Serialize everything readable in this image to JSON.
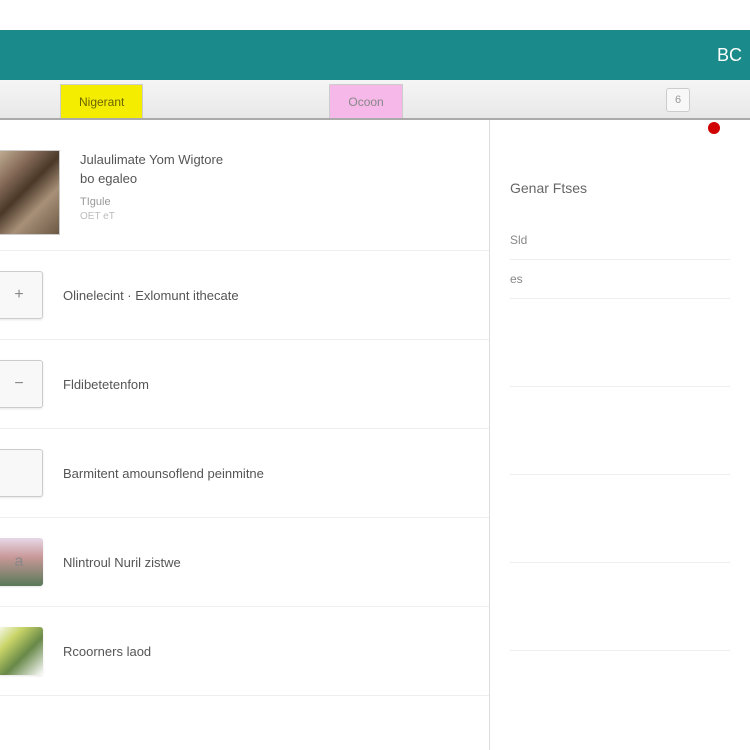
{
  "header": {
    "right_label": "BC"
  },
  "tabs": {
    "active": "Nigerant",
    "secondary": "Ocoon",
    "right_badge": "6"
  },
  "hero": {
    "title": "Julaulimate Yom Wigtore",
    "subtitle": "bo egaleo",
    "meta1": "TIgule",
    "meta2": "OET eT"
  },
  "list": [
    {
      "icon": "+",
      "text": "Olinelecint · Exlomunt ithecate"
    },
    {
      "icon": "−",
      "text": "Fldibetetenfom"
    },
    {
      "icon": "",
      "text": "Barmitent amounsoflend peinmitne"
    },
    {
      "icon": "a",
      "text": "Nlintroul Nuril zistwe"
    },
    {
      "icon": "",
      "text": "Rcoorners laod",
      "img": true
    }
  ],
  "sidebar": {
    "title": "Genar Ftses",
    "items": [
      "Sld",
      "es"
    ]
  }
}
